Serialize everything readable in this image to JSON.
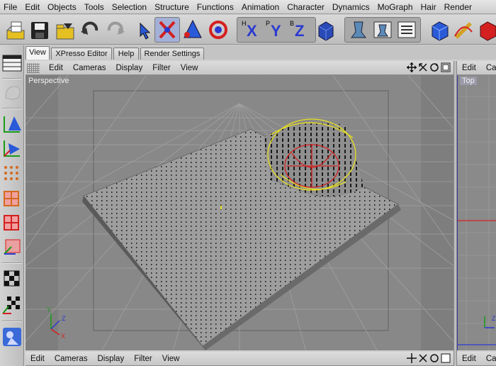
{
  "menu": [
    "File",
    "Edit",
    "Objects",
    "Tools",
    "Selection",
    "Structure",
    "Functions",
    "Animation",
    "Character",
    "Dynamics",
    "MoGraph",
    "Hair",
    "Render"
  ],
  "toolbar": {
    "icons": [
      "open-project-icon",
      "save-icon",
      "open-folder-icon",
      "undo-icon",
      "redo-icon",
      "select-arrow-icon",
      "move-tool-icon",
      "scale-tool-icon",
      "rotate-tool-icon",
      "x-axis-lock-icon",
      "y-axis-lock-icon",
      "z-axis-lock-icon",
      "coordinate-system-icon",
      "render-view-icon",
      "render-picture-viewer-icon",
      "render-settings-icon",
      "cube-object-icon",
      "spline-pen-icon",
      "nurbs-icon"
    ],
    "axis_x": "X",
    "axis_y": "Y",
    "axis_z": "Z",
    "axis_hx": "H",
    "axis_py": "P",
    "axis_bz": "B"
  },
  "tabs": [
    "View",
    "XPresso Editor",
    "Help",
    "Render Settings"
  ],
  "viewport_main": {
    "menus": [
      "Edit",
      "Cameras",
      "Display",
      "Filter",
      "View"
    ],
    "label": "Perspective"
  },
  "viewport_top": {
    "menus": [
      "Edit",
      "Ca"
    ],
    "label": "Top"
  },
  "viewport_bottom": {
    "menus": [
      "Edit",
      "Cameras",
      "Display",
      "Filter",
      "View"
    ]
  },
  "viewport_bottom_right": {
    "menus": [
      "Edit",
      "Ca"
    ]
  },
  "axis": {
    "y": "Y",
    "z": "Z",
    "x": "X"
  },
  "colors": {
    "accent_red": "#d42020",
    "axis_green": "#1a9a1a",
    "axis_blue": "#2a3ad0",
    "selection_yellow": "#e8e020"
  }
}
